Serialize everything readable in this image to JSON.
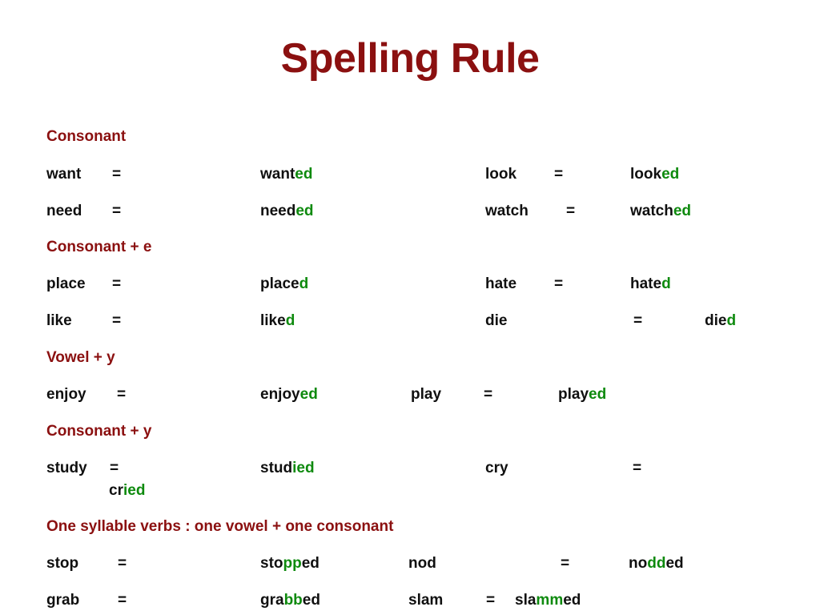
{
  "slide": {
    "title": "Spelling Rule",
    "title_color": "#8B1010",
    "heading_color": "#8B1010",
    "highlight_color": "#0E8A0E",
    "text_color": "#101010",
    "background_color": "#FFFFFF"
  },
  "sections": [
    {
      "heading": "Consonant",
      "rows": [
        {
          "base": "want",
          "equals": "=",
          "result_stem": "want",
          "result_suffix": "ed",
          "base2": "look",
          "equals2": "=",
          "result2_stem": "look",
          "result2_suffix": "ed"
        },
        {
          "base": "need",
          "equals": "=",
          "result_stem": "need",
          "result_suffix": "ed",
          "base2": "watch",
          "equals2": "=",
          "result2_stem": "watch",
          "result2_suffix": "ed"
        }
      ]
    },
    {
      "heading": "Consonant + e",
      "rows": [
        {
          "base": "place",
          "equals": "=",
          "result_stem": "place",
          "result_suffix": "d",
          "base2": "hate",
          "equals2": "=",
          "result2_stem": "hate",
          "result2_suffix": "d"
        },
        {
          "base": "like",
          "equals": "=",
          "result_stem": "like",
          "result_suffix": "d",
          "base2": "die",
          "equals2": "=",
          "result2_stem": "die",
          "result2_suffix": "d"
        }
      ]
    },
    {
      "heading": "Vowel + y",
      "rows": [
        {
          "base": "enjoy",
          "equals": "=",
          "result_stem": "enjoy",
          "result_suffix": "ed",
          "base2": "play",
          "equals2": "=",
          "result2_stem": "play",
          "result2_suffix": "ed"
        }
      ]
    },
    {
      "heading": "Consonant + y",
      "rows": [
        {
          "base": "study",
          "equals": "=",
          "result_stem": "stud",
          "result_suffix": "ied",
          "base2": "cry",
          "equals2": "=",
          "result2_stem": "cr",
          "result2_suffix": "ied"
        }
      ]
    },
    {
      "heading": "One syllable verbs : one vowel + one consonant",
      "rows": [
        {
          "base": "stop",
          "equals": "=",
          "result_stem": "sto",
          "result_suffix": "pp",
          "result_tail": "ed",
          "base2": "nod",
          "equals2": "=",
          "result2_stem": "no",
          "result2_suffix": "dd",
          "result2_tail": "ed"
        },
        {
          "base": "grab",
          "equals": "=",
          "result_stem": "gra",
          "result_suffix": "bb",
          "result_tail": "ed",
          "base2": "slam",
          "equals2": "=",
          "result2_stem": "sla",
          "result2_suffix": "mm",
          "result2_tail": "ed"
        }
      ]
    }
  ]
}
